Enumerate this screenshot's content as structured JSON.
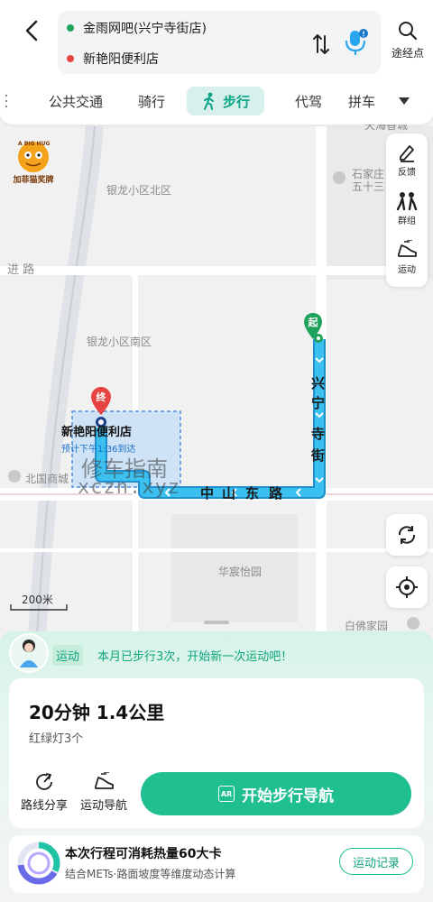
{
  "header": {
    "origin": "金雨网吧(兴宁寺街店)",
    "destination": "新艳阳便利店",
    "waypoint_label": "途经点"
  },
  "modes": {
    "items": [
      "公共交通",
      "骑行",
      "步行",
      "代驾",
      "拼车"
    ],
    "active": "步行"
  },
  "map": {
    "labels": {
      "tianhai": "天海香城",
      "shijiazhuang": "石家庄",
      "wushisan": "五十三",
      "yinlong_north": "银龙小区北区",
      "yinlong_south": "银龙小区南区",
      "huachen": "华宸怡园",
      "baifo": "白佛家园",
      "beiguo": "北国商城",
      "jinjin_road": "进 路",
      "street_xingning": [
        "兴",
        "宁",
        "寺",
        "街"
      ],
      "road_zhongshan": [
        "中",
        "山",
        "东",
        "路"
      ],
      "scale": "200米"
    },
    "start_marker": "起",
    "end_marker": "终",
    "dest_name": "新艳阳便利店",
    "eta": "预计下午1:36到达",
    "watermark_cn": "修车指南",
    "watermark_en": "xczn.xyz",
    "logo_text": "加菲猫奖牌",
    "logo_top_text": "A BIG HUG"
  },
  "tools": {
    "feedback": "反馈",
    "group": "群组",
    "sport": "运动"
  },
  "panel": {
    "badge": "运动",
    "tip": "本月已步行3次，开始新一次运动吧！",
    "duration": "20分钟  1.4公里",
    "lights": "红绿灯3个",
    "share": "路线分享",
    "sport_nav": "运动导航",
    "start_nav": "开始步行导航",
    "ar": "AR"
  },
  "calorie": {
    "title": "本次行程可消耗热量60大卡",
    "sub": "结合METs·路面坡度等维度动态计算",
    "record": "运动记录"
  },
  "colors": {
    "accent": "#1fbf90",
    "route": "#2bb3e6",
    "start": "#1fa35c",
    "end": "#e64340"
  }
}
